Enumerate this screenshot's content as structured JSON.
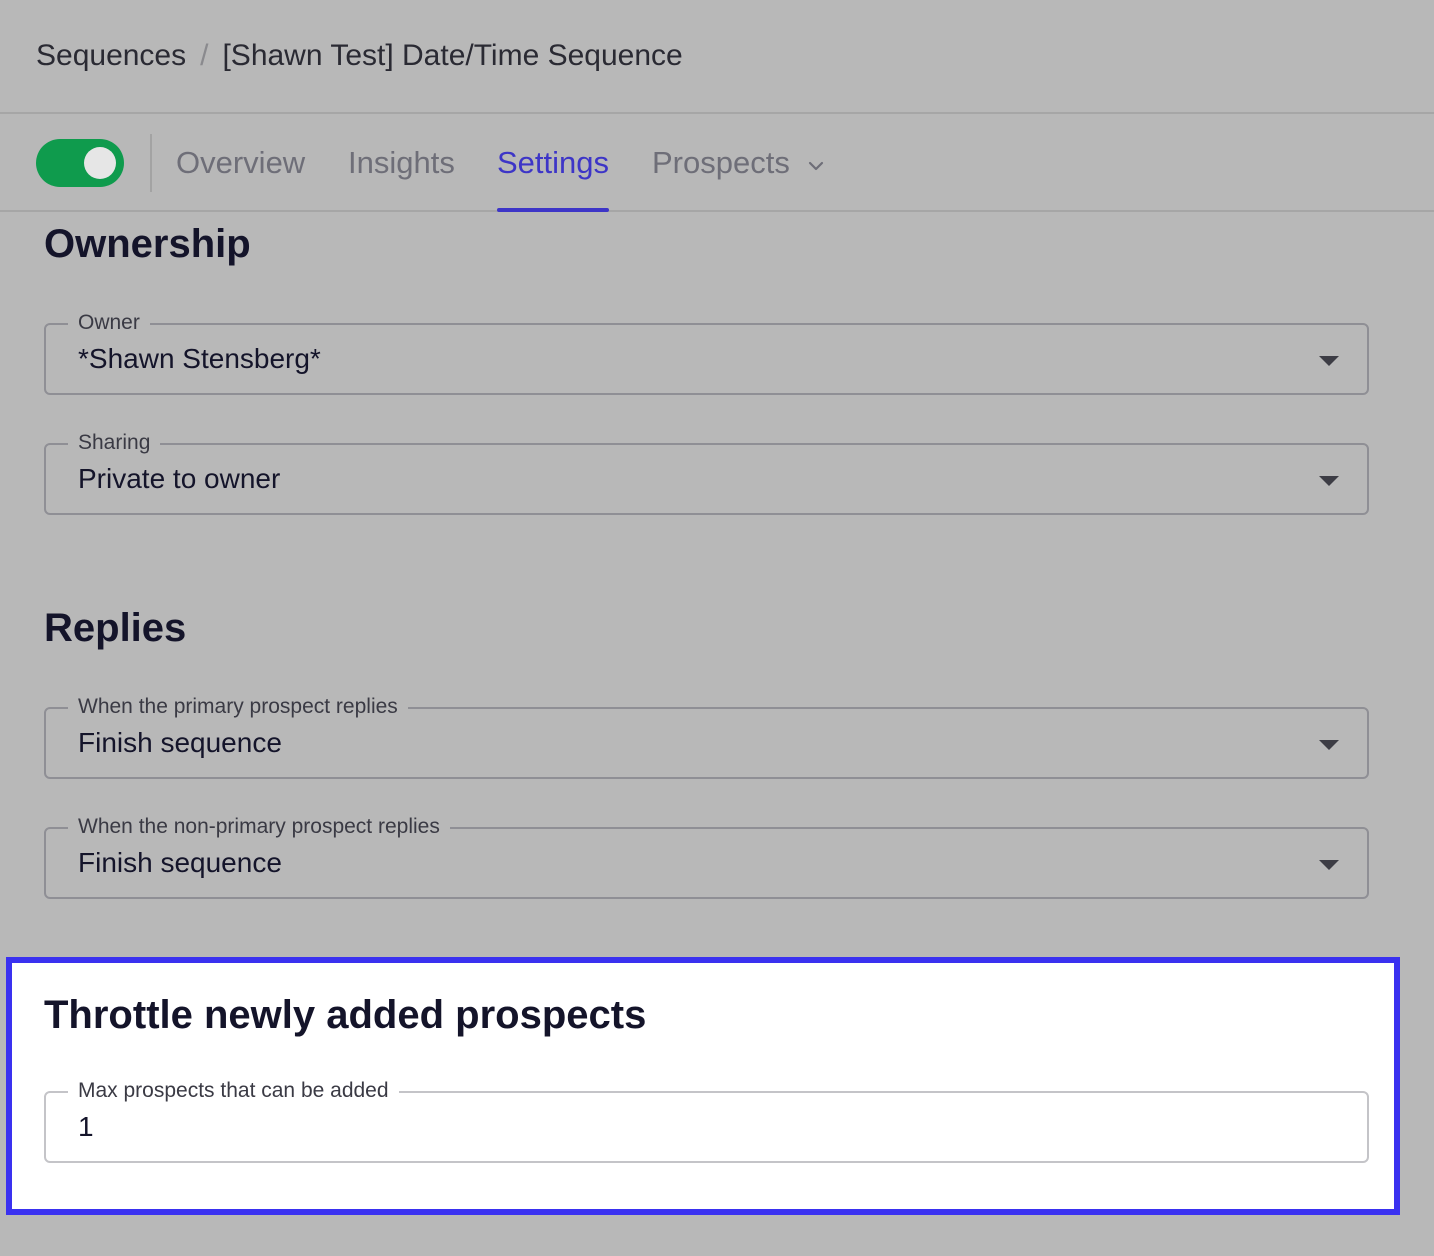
{
  "breadcrumb": {
    "root": "Sequences",
    "separator": "/",
    "current": "[Shawn Test] Date/Time Sequence"
  },
  "tabs": {
    "overview": "Overview",
    "insights": "Insights",
    "settings": "Settings",
    "prospects": "Prospects",
    "active": "settings"
  },
  "toggle": {
    "enabled": true,
    "color": "#0f9b4d"
  },
  "ownership": {
    "title": "Ownership",
    "owner": {
      "label": "Owner",
      "value": "*Shawn Stensberg*"
    },
    "sharing": {
      "label": "Sharing",
      "value": "Private to owner"
    }
  },
  "replies": {
    "title": "Replies",
    "primary": {
      "label": "When the primary prospect replies",
      "value": "Finish sequence"
    },
    "non_primary": {
      "label": "When the non-primary prospect replies",
      "value": "Finish sequence"
    }
  },
  "throttle": {
    "title": "Throttle newly added prospects",
    "max": {
      "label": "Max prospects that can be added",
      "value": "1"
    }
  },
  "colors": {
    "accent": "#3d35c7",
    "highlight_border": "#3a31f0",
    "overlay": "#b8b8b8"
  }
}
